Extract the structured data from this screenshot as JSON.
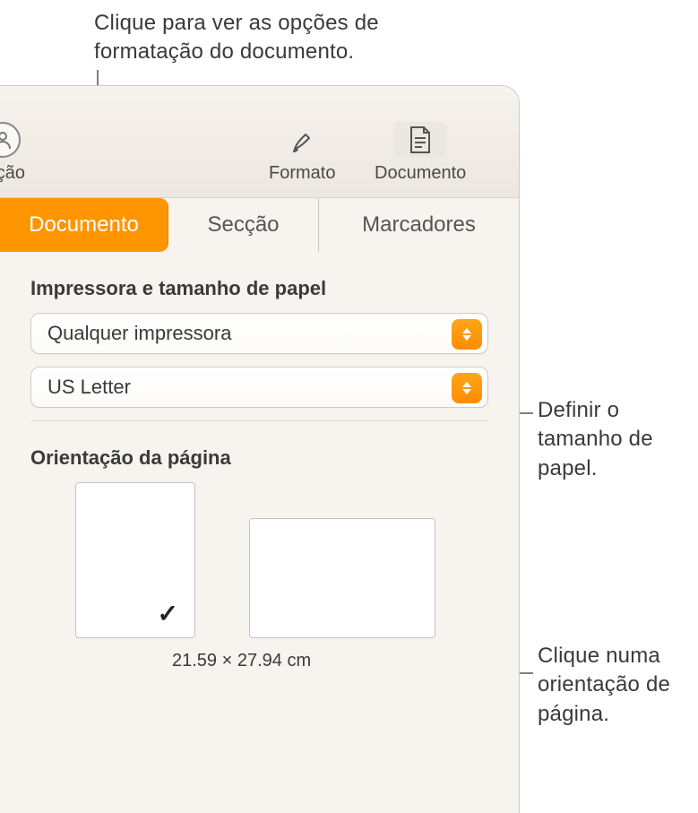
{
  "callouts": {
    "top": "Clique para ver as opções de formatação do documento.",
    "paper": "Definir o tamanho de papel.",
    "orient": "Clique numa orientação de página."
  },
  "toolbar": {
    "config_label_fragment": "ração",
    "formato_label": "Formato",
    "documento_label": "Documento"
  },
  "tabs": {
    "documento": "Documento",
    "seccao": "Secção",
    "marcadores": "Marcadores"
  },
  "printer_section": {
    "title": "Impressora e tamanho de papel",
    "printer_value": "Qualquer impressora",
    "paper_value": "US Letter"
  },
  "orientation_section": {
    "title": "Orientação da página",
    "dimensions": "21.59 × 27.94 cm"
  }
}
